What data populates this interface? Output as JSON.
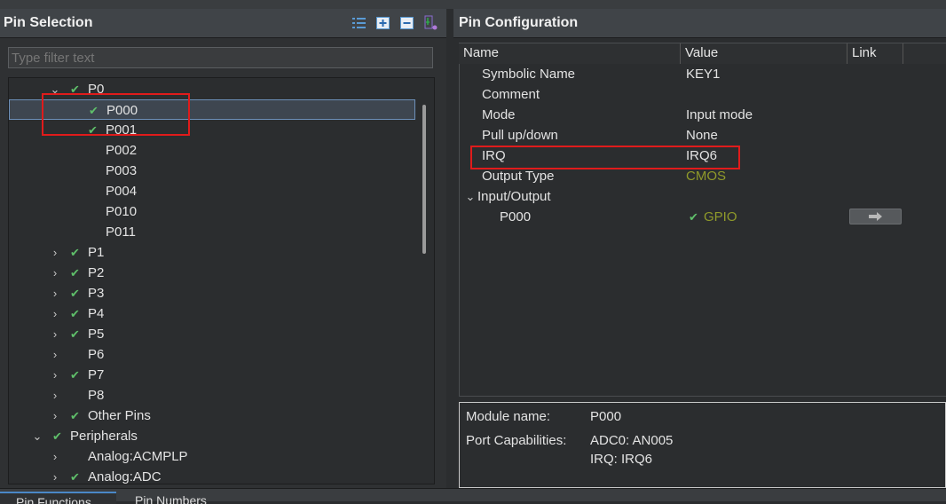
{
  "left": {
    "title": "Pin Selection",
    "filter_placeholder": "Type filter text",
    "tree": [
      {
        "label": "P0",
        "twisty": "⌄",
        "check": true,
        "indent": 1
      },
      {
        "label": "P000",
        "twisty": "",
        "check": true,
        "indent": 2,
        "selected": true
      },
      {
        "label": "P001",
        "twisty": "",
        "check": true,
        "indent": 2
      },
      {
        "label": "P002",
        "twisty": "",
        "check": false,
        "indent": 2
      },
      {
        "label": "P003",
        "twisty": "",
        "check": false,
        "indent": 2
      },
      {
        "label": "P004",
        "twisty": "",
        "check": false,
        "indent": 2
      },
      {
        "label": "P010",
        "twisty": "",
        "check": false,
        "indent": 2
      },
      {
        "label": "P011",
        "twisty": "",
        "check": false,
        "indent": 2
      },
      {
        "label": "P1",
        "twisty": "›",
        "check": true,
        "indent": 1
      },
      {
        "label": "P2",
        "twisty": "›",
        "check": true,
        "indent": 1
      },
      {
        "label": "P3",
        "twisty": "›",
        "check": true,
        "indent": 1
      },
      {
        "label": "P4",
        "twisty": "›",
        "check": true,
        "indent": 1
      },
      {
        "label": "P5",
        "twisty": "›",
        "check": true,
        "indent": 1
      },
      {
        "label": "P6",
        "twisty": "›",
        "check": false,
        "indent": 1
      },
      {
        "label": "P7",
        "twisty": "›",
        "check": true,
        "indent": 1
      },
      {
        "label": "P8",
        "twisty": "›",
        "check": false,
        "indent": 1
      },
      {
        "label": "Other Pins",
        "twisty": "›",
        "check": true,
        "indent": 1
      },
      {
        "label": "Peripherals",
        "twisty": "⌄",
        "check": true,
        "indent": 0
      },
      {
        "label": "Analog:ACMPLP",
        "twisty": "›",
        "check": false,
        "indent": 1
      },
      {
        "label": "Analog:ADC",
        "twisty": "›",
        "check": true,
        "indent": 1
      }
    ]
  },
  "right": {
    "title": "Pin Configuration",
    "columns": [
      "Name",
      "Value",
      "Link"
    ],
    "rows": [
      {
        "name": "Symbolic Name",
        "value": "KEY1",
        "indent": 1,
        "twisty": "",
        "check": false,
        "olive": false,
        "link": false
      },
      {
        "name": "Comment",
        "value": "",
        "indent": 1,
        "twisty": "",
        "check": false,
        "olive": false,
        "link": false
      },
      {
        "name": "Mode",
        "value": "Input mode",
        "indent": 1,
        "twisty": "",
        "check": false,
        "olive": false,
        "link": false
      },
      {
        "name": "Pull up/down",
        "value": "None",
        "indent": 1,
        "twisty": "",
        "check": false,
        "olive": false,
        "link": false
      },
      {
        "name": "IRQ",
        "value": "IRQ6",
        "indent": 1,
        "twisty": "",
        "check": false,
        "olive": false,
        "link": false
      },
      {
        "name": "Output Type",
        "value": "CMOS",
        "indent": 1,
        "twisty": "",
        "check": false,
        "olive": true,
        "link": false
      },
      {
        "name": "Input/Output",
        "value": "",
        "indent": 0,
        "twisty": "⌄",
        "check": false,
        "olive": false,
        "link": false
      },
      {
        "name": "P000",
        "value": "GPIO",
        "indent": 2,
        "twisty": "",
        "check": true,
        "olive": true,
        "link": true
      }
    ],
    "info": {
      "module_label": "Module name:",
      "module_value": "P000",
      "port_label": "Port Capabilities:",
      "port_values": [
        "ADC0: AN005",
        "IRQ: IRQ6"
      ]
    }
  },
  "bottom_tabs": [
    "Pin Functions",
    "Pin Numbers"
  ],
  "colors": {
    "accent_check": "#5fbf6a",
    "highlight": "#e01b1b",
    "olive": "#8f9a2a"
  }
}
